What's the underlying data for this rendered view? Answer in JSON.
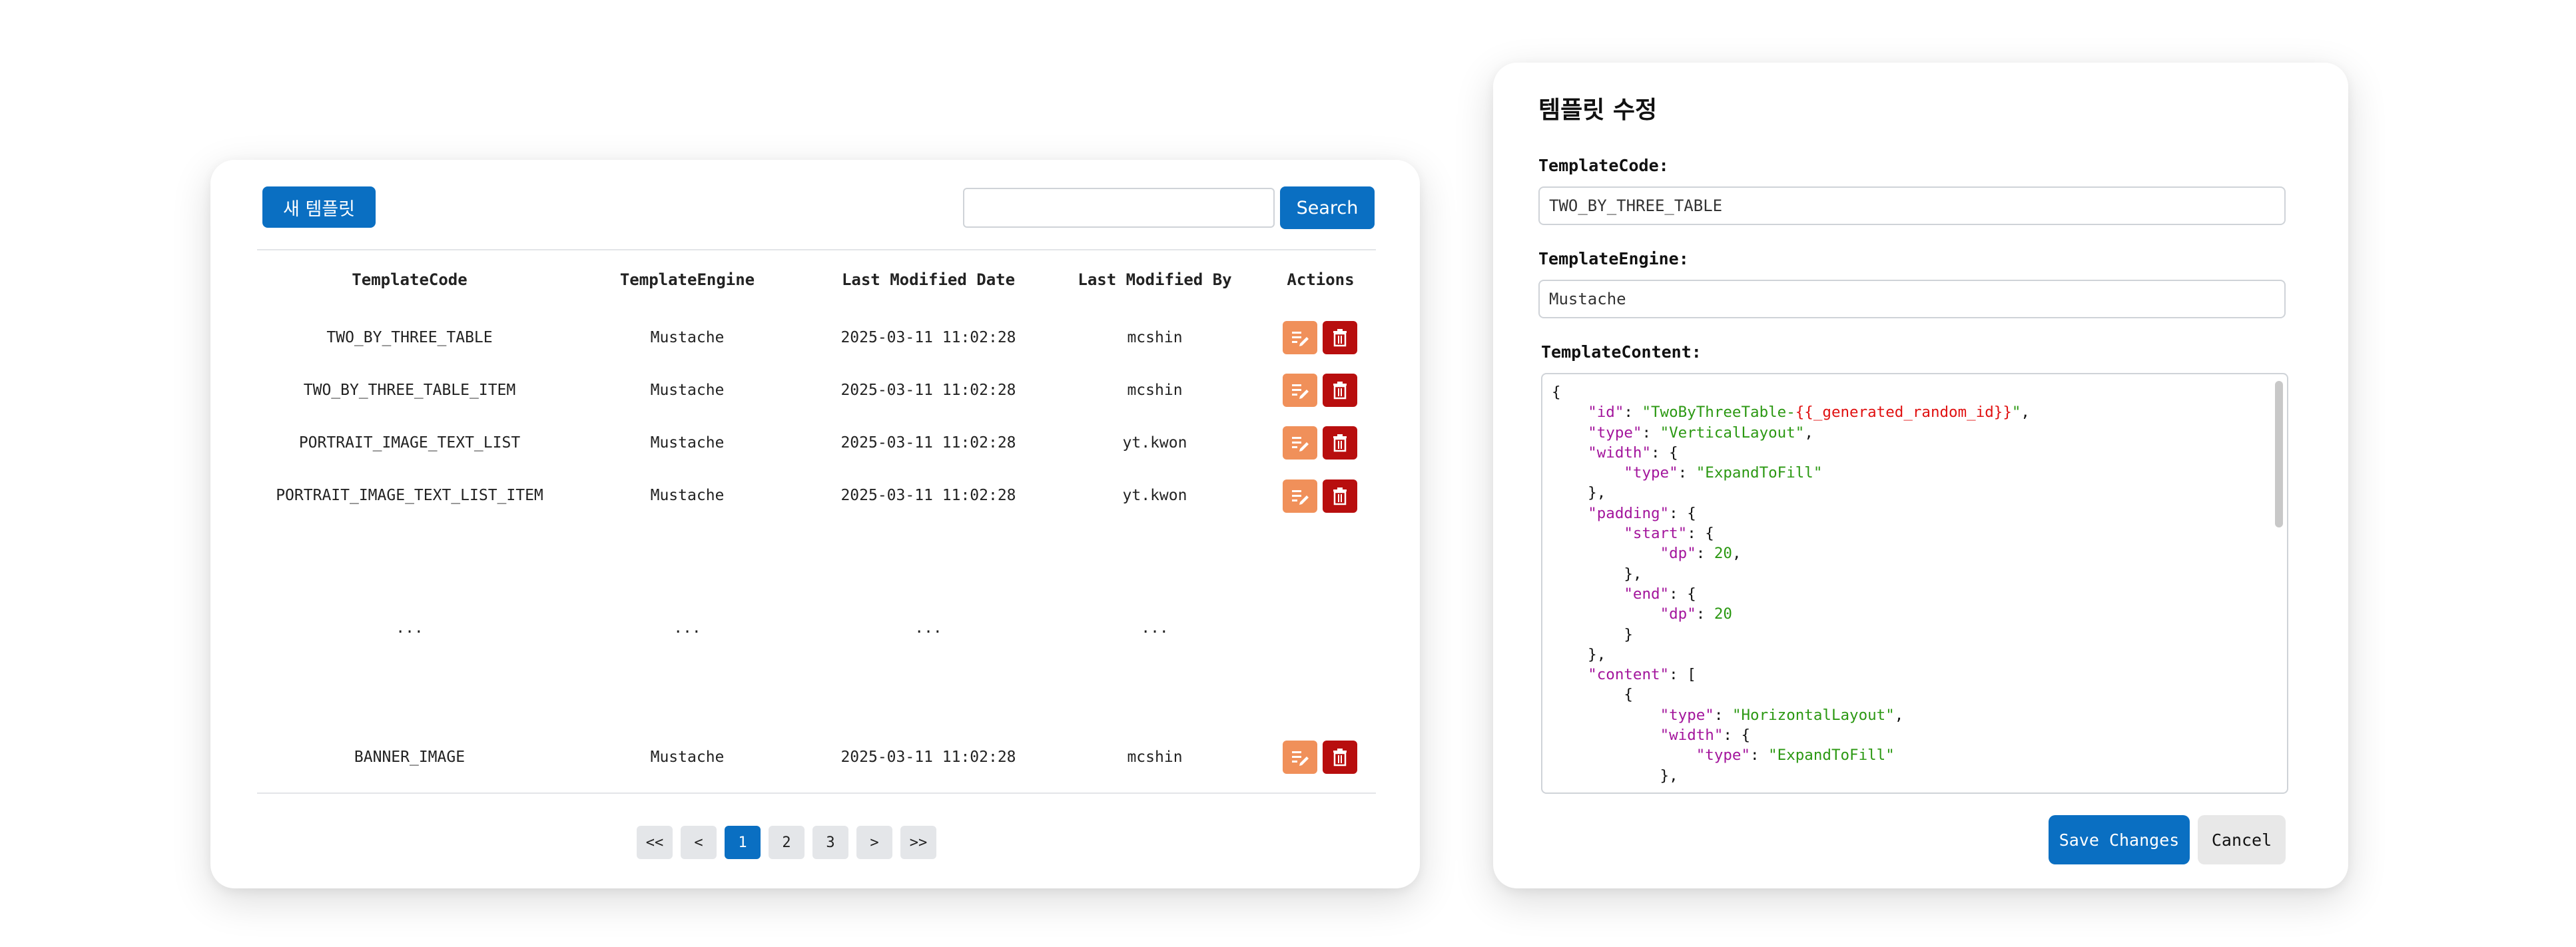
{
  "list": {
    "new_button": "새 템플릿",
    "search_placeholder": "",
    "search_button": "Search",
    "headers": [
      "TemplateCode",
      "TemplateEngine",
      "Last Modified Date",
      "Last Modified By",
      "Actions"
    ],
    "rows": [
      {
        "code": "TWO_BY_THREE_TABLE",
        "engine": "Mustache",
        "date": "2025-03-11 11:02:28",
        "by": "mcshin"
      },
      {
        "code": "TWO_BY_THREE_TABLE_ITEM",
        "engine": "Mustache",
        "date": "2025-03-11 11:02:28",
        "by": "mcshin"
      },
      {
        "code": "PORTRAIT_IMAGE_TEXT_LIST",
        "engine": "Mustache",
        "date": "2025-03-11 11:02:28",
        "by": "yt.kwon"
      },
      {
        "code": "PORTRAIT_IMAGE_TEXT_LIST_ITEM",
        "engine": "Mustache",
        "date": "2025-03-11 11:02:28",
        "by": "yt.kwon"
      },
      {
        "code": "...",
        "engine": "...",
        "date": "...",
        "by": "..."
      },
      {
        "code": "BANNER_IMAGE",
        "engine": "Mustache",
        "date": "2025-03-11 11:02:28",
        "by": "mcshin"
      }
    ],
    "pagination": {
      "first": "<<",
      "prev": "<",
      "pages": [
        "1",
        "2",
        "3"
      ],
      "current": "1",
      "next": ">",
      "last": ">>"
    }
  },
  "editor": {
    "title": "템플릿 수정",
    "code_label": "TemplateCode:",
    "code_value": "TWO_BY_THREE_TABLE",
    "engine_label": "TemplateEngine:",
    "engine_value": "Mustache",
    "content_label": "TemplateContent:",
    "content_lines": [
      "{",
      "    \"id\": \"TwoByThreeTable-{{_generated_random_id}}\",",
      "    \"type\": \"VerticalLayout\",",
      "    \"width\": {",
      "        \"type\": \"ExpandToFill\"",
      "    },",
      "    \"padding\": {",
      "        \"start\": {",
      "            \"dp\": 20,",
      "        },",
      "        \"end\": {",
      "            \"dp\": 20",
      "        }",
      "    },",
      "    \"content\": [",
      "        {",
      "            \"type\": \"HorizontalLayout\",",
      "            \"width\": {",
      "                \"type\": \"ExpandToFill\"",
      "            },"
    ],
    "save_button": "Save Changes",
    "cancel_button": "Cancel"
  },
  "colors": {
    "primary": "#0a6fc2",
    "edit_action": "#f0905a",
    "delete_action": "#b80e0e",
    "json_key": "#a3159c",
    "json_string": "#2b9812",
    "template_var": "#e01010"
  }
}
